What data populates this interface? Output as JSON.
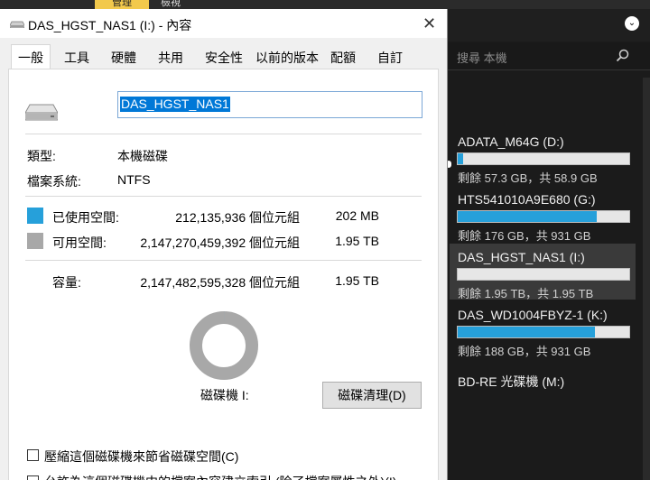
{
  "background_window": {
    "ribbon_tabs": [
      "管理",
      "檢視"
    ],
    "search_placeholder": "搜尋 本機",
    "drives": [
      {
        "name": "ADATA_M64G (D:)",
        "info": "剩餘 57.3 GB，共 58.9 GB",
        "used_fraction": 0.03,
        "selected": false
      },
      {
        "name": "HTS541010A9E680 (G:)",
        "info": "剩餘 176 GB，共 931 GB",
        "used_fraction": 0.81,
        "selected": false
      },
      {
        "name": "DAS_HGST_NAS1 (I:)",
        "info": "剩餘 1.95 TB，共 1.95 TB",
        "used_fraction": 0.0,
        "selected": true
      },
      {
        "name": "DAS_WD1004FBYZ-1 (K:)",
        "info": "剩餘 188 GB，共 931 GB",
        "used_fraction": 0.8,
        "selected": false
      }
    ],
    "optical_drive": "BD-RE 光碟機 (M:)"
  },
  "dialog": {
    "title": "DAS_HGST_NAS1 (I:) - 內容",
    "close_glyph": "✕",
    "tabs": [
      "一般",
      "工具",
      "硬體",
      "共用",
      "安全性",
      "以前的版本",
      "配額",
      "自訂"
    ],
    "active_tab": 0,
    "volume_name": "DAS_HGST_NAS1",
    "type_label": "類型:",
    "type_value": "本機磁碟",
    "fs_label": "檔案系統:",
    "fs_value": "NTFS",
    "used_label": "已使用空間:",
    "used_bytes": "212,135,936 個位元組",
    "used_size": "202 MB",
    "free_label": "可用空間:",
    "free_bytes": "2,147,270,459,392 個位元組",
    "free_size": "1.95 TB",
    "capacity_label": "容量:",
    "capacity_bytes": "2,147,482,595,328 個位元組",
    "capacity_size": "1.95 TB",
    "drive_label": "磁碟機 I:",
    "cleanup_button": "磁碟清理(D)",
    "compress_checkbox": "壓縮這個磁碟機來節省磁碟空間(C)",
    "index_checkbox": "允許為這個磁碟機中的檔案內容建立索引 (除了檔案屬性之外)(I)",
    "used_color": "#26a0da",
    "free_color": "#a8a8a8",
    "used_fraction": 0.0001
  }
}
